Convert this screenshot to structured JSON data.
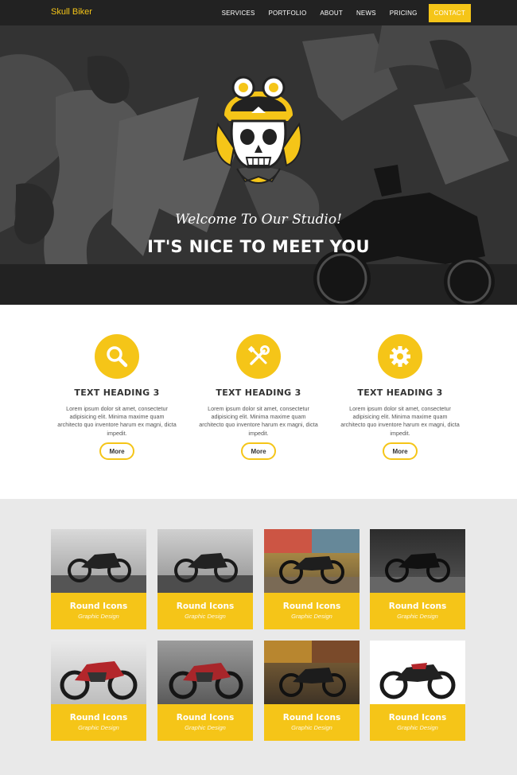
{
  "nav": {
    "brand": "Skull Biker",
    "items": [
      "SERVICES",
      "PORTFOLIO",
      "ABOUT",
      "NEWS",
      "PRICING",
      "CONTACT"
    ]
  },
  "hero": {
    "script": "Welcome To Our Studio!",
    "title": "IT'S NICE TO MEET YOU"
  },
  "features": [
    {
      "icon": "search-icon",
      "heading": "TEXT HEADING 3",
      "text": "Lorem ipsum dolor sit amet, consectetur adipisicing elit. Minima maxime quam architecto quo inventore harum ex magni, dicta impedit.",
      "button": "More"
    },
    {
      "icon": "tools-icon",
      "heading": "TEXT HEADING 3",
      "text": "Lorem ipsum dolor sit amet, consectetur adipisicing elit. Minima maxime quam architecto quo inventore harum ex magni, dicta impedit.",
      "button": "More"
    },
    {
      "icon": "gear-icon",
      "heading": "TEXT HEADING 3",
      "text": "Lorem ipsum dolor sit amet, consectetur adipisicing elit. Minima maxime quam architecto quo inventore harum ex magni, dicta impedit.",
      "button": "More"
    }
  ],
  "portfolio": [
    {
      "title": "Round Icons",
      "subtitle": "Graphic Design"
    },
    {
      "title": "Round Icons",
      "subtitle": "Graphic Design"
    },
    {
      "title": "Round Icons",
      "subtitle": "Graphic Design"
    },
    {
      "title": "Round Icons",
      "subtitle": "Graphic Design"
    },
    {
      "title": "Round Icons",
      "subtitle": "Graphic Design"
    },
    {
      "title": "Round Icons",
      "subtitle": "Graphic Design"
    },
    {
      "title": "Round Icons",
      "subtitle": "Graphic Design"
    },
    {
      "title": "Round Icons",
      "subtitle": "Graphic Design"
    }
  ],
  "colors": {
    "accent": "#f5c518",
    "nav_bg": "#222222",
    "portfolio_bg": "#e9e9e9"
  }
}
